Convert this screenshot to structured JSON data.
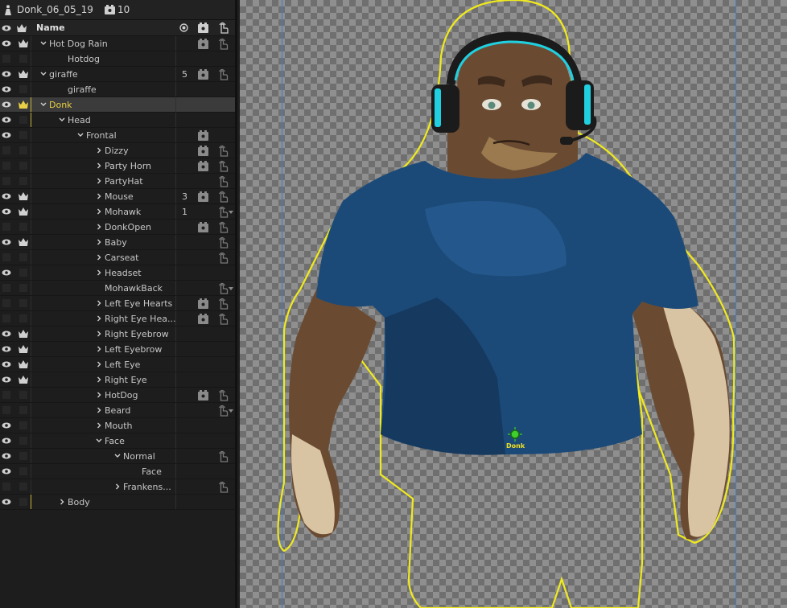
{
  "document": {
    "title": "Donk_06_05_19",
    "scene_count": "10"
  },
  "columns": {
    "name": "Name"
  },
  "rows": [
    {
      "label": "Hot Dog Rain",
      "depth": 0,
      "chevron": "down",
      "eye": true,
      "crown": true,
      "num": "",
      "camera": true,
      "hand": true,
      "caret": false
    },
    {
      "label": "Hotdog",
      "depth": 1,
      "chevron": "none",
      "eye": false,
      "crown": false,
      "num": "",
      "camera": false,
      "hand": false,
      "caret": false
    },
    {
      "label": "giraffe",
      "depth": 0,
      "chevron": "down",
      "eye": true,
      "crown": true,
      "num": "5",
      "camera": true,
      "hand": true,
      "caret": false
    },
    {
      "label": "giraffe",
      "depth": 1,
      "chevron": "none",
      "eye": true,
      "crown": false,
      "num": "",
      "camera": false,
      "hand": false,
      "caret": false
    },
    {
      "label": "Donk",
      "depth": 0,
      "chevron": "down",
      "eye": true,
      "crown": true,
      "num": "",
      "camera": false,
      "hand": false,
      "caret": false,
      "selected": true
    },
    {
      "label": "Head",
      "depth": 1,
      "chevron": "down",
      "eye": true,
      "crown": false,
      "num": "",
      "camera": false,
      "hand": false,
      "caret": false
    },
    {
      "label": "Frontal",
      "depth": 2,
      "chevron": "down",
      "eye": true,
      "crown": false,
      "num": "",
      "camera": true,
      "hand": false,
      "caret": false
    },
    {
      "label": "Dizzy",
      "depth": 3,
      "chevron": "right",
      "eye": false,
      "crown": false,
      "num": "",
      "camera": true,
      "hand": true,
      "caret": false
    },
    {
      "label": "Party Horn",
      "depth": 3,
      "chevron": "right",
      "eye": false,
      "crown": false,
      "num": "",
      "camera": true,
      "hand": true,
      "caret": false
    },
    {
      "label": "PartyHat",
      "depth": 3,
      "chevron": "right",
      "eye": false,
      "crown": false,
      "num": "",
      "camera": false,
      "hand": true,
      "caret": false
    },
    {
      "label": "Mouse",
      "depth": 3,
      "chevron": "right",
      "eye": true,
      "crown": true,
      "num": "3",
      "camera": true,
      "hand": true,
      "caret": false
    },
    {
      "label": "Mohawk",
      "depth": 3,
      "chevron": "right",
      "eye": true,
      "crown": true,
      "num": "1",
      "camera": false,
      "hand": true,
      "caret": true
    },
    {
      "label": "DonkOpen",
      "depth": 3,
      "chevron": "right",
      "eye": false,
      "crown": false,
      "num": "",
      "camera": true,
      "hand": true,
      "caret": false
    },
    {
      "label": "Baby",
      "depth": 3,
      "chevron": "right",
      "eye": true,
      "crown": true,
      "num": "",
      "camera": false,
      "hand": true,
      "caret": false
    },
    {
      "label": "Carseat",
      "depth": 3,
      "chevron": "right",
      "eye": false,
      "crown": false,
      "num": "",
      "camera": false,
      "hand": true,
      "caret": false
    },
    {
      "label": "Headset",
      "depth": 3,
      "chevron": "right",
      "eye": true,
      "crown": false,
      "num": "",
      "camera": false,
      "hand": false,
      "caret": false
    },
    {
      "label": "MohawkBack",
      "depth": 3,
      "chevron": "none",
      "eye": false,
      "crown": false,
      "num": "",
      "camera": false,
      "hand": true,
      "caret": true
    },
    {
      "label": "Left Eye Hearts",
      "depth": 3,
      "chevron": "right",
      "eye": false,
      "crown": false,
      "num": "",
      "camera": true,
      "hand": true,
      "caret": false
    },
    {
      "label": "Right Eye Hea...",
      "depth": 3,
      "chevron": "right",
      "eye": false,
      "crown": false,
      "num": "",
      "camera": true,
      "hand": true,
      "caret": false
    },
    {
      "label": "Right Eyebrow",
      "depth": 3,
      "chevron": "right",
      "eye": true,
      "crown": true,
      "num": "",
      "camera": false,
      "hand": false,
      "caret": false
    },
    {
      "label": "Left Eyebrow",
      "depth": 3,
      "chevron": "right",
      "eye": true,
      "crown": true,
      "num": "",
      "camera": false,
      "hand": false,
      "caret": false
    },
    {
      "label": "Left Eye",
      "depth": 3,
      "chevron": "right",
      "eye": true,
      "crown": true,
      "num": "",
      "camera": false,
      "hand": false,
      "caret": false
    },
    {
      "label": "Right Eye",
      "depth": 3,
      "chevron": "right",
      "eye": true,
      "crown": true,
      "num": "",
      "camera": false,
      "hand": false,
      "caret": false
    },
    {
      "label": "HotDog",
      "depth": 3,
      "chevron": "right",
      "eye": false,
      "crown": false,
      "num": "",
      "camera": true,
      "hand": true,
      "caret": false
    },
    {
      "label": "Beard",
      "depth": 3,
      "chevron": "right",
      "eye": false,
      "crown": false,
      "num": "",
      "camera": false,
      "hand": true,
      "caret": true
    },
    {
      "label": "Mouth",
      "depth": 3,
      "chevron": "right",
      "eye": true,
      "crown": false,
      "num": "",
      "camera": false,
      "hand": false,
      "caret": false
    },
    {
      "label": "Face",
      "depth": 3,
      "chevron": "down",
      "eye": true,
      "crown": false,
      "num": "",
      "camera": false,
      "hand": false,
      "caret": false
    },
    {
      "label": "Normal",
      "depth": 4,
      "chevron": "down",
      "eye": true,
      "crown": false,
      "num": "",
      "camera": false,
      "hand": true,
      "caret": false
    },
    {
      "label": "Face",
      "depth": 5,
      "chevron": "none",
      "eye": true,
      "crown": false,
      "num": "",
      "camera": false,
      "hand": false,
      "caret": false
    },
    {
      "label": "Frankens...",
      "depth": 4,
      "chevron": "right",
      "eye": false,
      "crown": false,
      "num": "",
      "camera": false,
      "hand": true,
      "caret": false
    },
    {
      "label": "Body",
      "depth": 1,
      "chevron": "right",
      "eye": true,
      "crown": false,
      "num": "",
      "camera": false,
      "hand": false,
      "caret": false
    }
  ],
  "canvas": {
    "origin_label": "Donk"
  },
  "colors": {
    "selection": "#e8cf46",
    "outline": "#f0ea1c",
    "shirt": "#1c4a78",
    "skin_dark": "#6a4b32",
    "skin_light": "#d8c3a2",
    "headset_accent": "#20d0e0",
    "guide": "#3d7fd0"
  }
}
